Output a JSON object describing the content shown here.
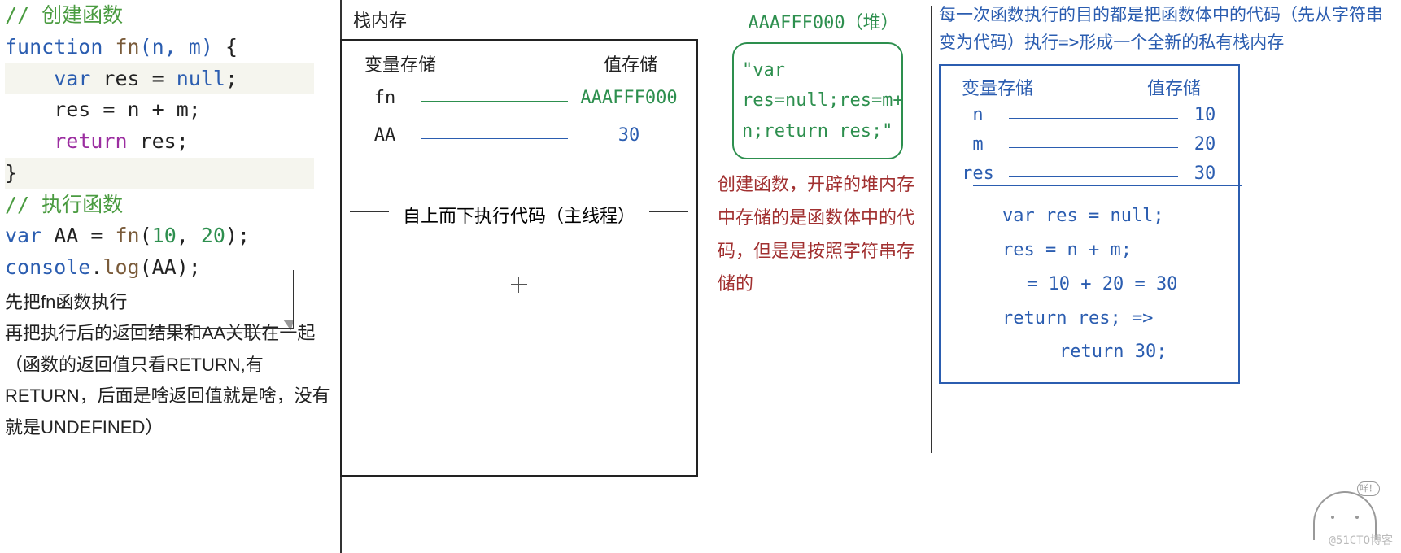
{
  "code": {
    "c1": "// 创建函数",
    "l2_kw": "function",
    "l2_fn": "fn",
    "l2_args": "(n, m)",
    "l2_brace": " {",
    "l3_var": "var",
    "l3_name": " res ",
    "l3_eq": "= ",
    "l3_null": "null",
    "l3_semi": ";",
    "l4": "    res = n + m;",
    "l5_ret": "return",
    "l5_rest": " res;",
    "l6": "}",
    "c2": "// 执行函数",
    "l8_var": "var",
    "l8_name": " AA = ",
    "l8_fn": "fn",
    "l8_args": "(",
    "l8_n1": "10",
    "l8_comma": ", ",
    "l8_n2": "20",
    "l8_close": ");",
    "l9_console": "console",
    "l9_dot": ".",
    "l9_log": "log",
    "l9_rest": "(AA);"
  },
  "code_expl": {
    "p1": "先把fn函数执行",
    "p2": "再把执行后的返回结果和AA关联在一起",
    "p3": "（函数的返回值只看RETURN,有RETURN，后面是啥返回值就是啥，没有就是UNDEFINED）"
  },
  "stack": {
    "title": "栈内存",
    "hdr_var": "变量存储",
    "hdr_val": "值存储",
    "rows": [
      {
        "name": "fn",
        "value": "AAAFFF000",
        "color": "green"
      },
      {
        "name": "AA",
        "value": "30",
        "color": "blue"
      }
    ],
    "midline": "自上而下执行代码（主线程）"
  },
  "heap": {
    "title": "AAAFFF000（堆）",
    "body_l1": "\"var",
    "body_l2": "res=null;res=m+",
    "body_l3": "n;return res;\"",
    "expl": "创建函数，开辟的堆内存中存储的是函数体中的代码，但是是按照字符串存储的"
  },
  "priv": {
    "intro": "每一次函数执行的目的都是把函数体中的代码（先从字符串变为代码）执行=>形成一个全新的私有栈内存",
    "hdr_var": "变量存储",
    "hdr_val": "值存储",
    "rows": [
      {
        "name": "n",
        "value": "10"
      },
      {
        "name": "m",
        "value": "20"
      },
      {
        "name": "res",
        "value": "30"
      }
    ],
    "code": {
      "l1": "var res = null;",
      "l2": "res = n + m;",
      "l3": "= 10 + 20 = 30",
      "l4": "return res;  =>",
      "l5": "return 30;"
    }
  },
  "bubble": "咩！"
}
